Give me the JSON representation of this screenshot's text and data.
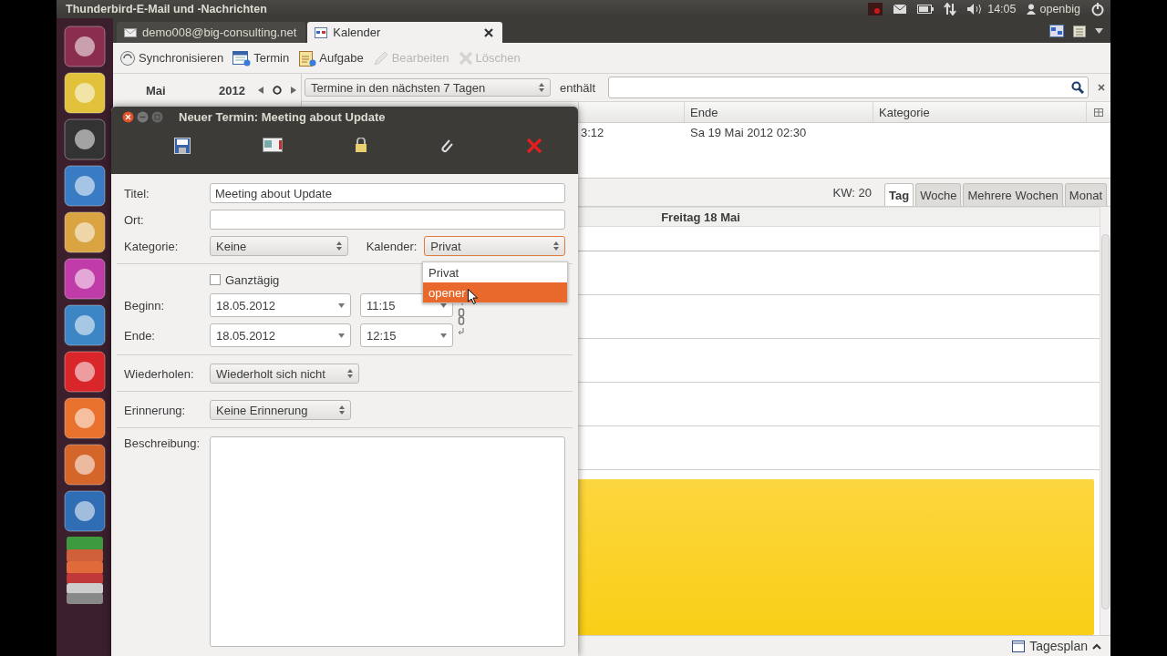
{
  "top_bar": {
    "title": "Thunderbird-E-Mail und -Nachrichten",
    "clock": "14:05",
    "user": "openbig"
  },
  "tabs": [
    {
      "label": "demo008@big-consulting.net",
      "selected": false,
      "kind": "mail"
    },
    {
      "label": "Kalender",
      "selected": true,
      "kind": "calendar"
    }
  ],
  "toolbar": [
    {
      "label": "Synchronisieren",
      "disabled": false,
      "kind": "sync"
    },
    {
      "label": "Termin",
      "disabled": false,
      "kind": "event"
    },
    {
      "label": "Aufgabe",
      "disabled": false,
      "kind": "task"
    },
    {
      "label": "Bearbeiten",
      "disabled": true,
      "kind": "edit"
    },
    {
      "label": "Löschen",
      "disabled": true,
      "kind": "delete"
    }
  ],
  "mini_calendar": {
    "month": "Mai",
    "year": "2012"
  },
  "filter": {
    "range": "Termine in den nächsten 7 Tagen",
    "contains_label": "enthält"
  },
  "event_list": {
    "columns": [
      "Ende",
      "Kategorie"
    ],
    "rows": [
      {
        "column_2": "3:12",
        "end": "Sa 19 Mai 2012 02:30"
      }
    ]
  },
  "view": {
    "week_label": "KW: 20",
    "tabs": [
      {
        "label": "Tag",
        "selected": true
      },
      {
        "label": "Woche",
        "selected": false
      },
      {
        "label": "Mehrere Wochen",
        "selected": false
      },
      {
        "label": "Monat",
        "selected": false
      }
    ],
    "day_header": "Freitag 18 Mai"
  },
  "status_bar": {
    "today_pane": "Tagesplan"
  },
  "dialog": {
    "title": "Neuer Termin: Meeting about Update",
    "title_label": "Titel:",
    "title_value": "Meeting about Update",
    "location_label": "Ort:",
    "category_label": "Kategorie:",
    "category_value": "Keine",
    "calendar_label": "Kalender:",
    "calendar_value": "Privat",
    "calendar_options": [
      {
        "label": "Privat",
        "selected": false
      },
      {
        "label": "opener",
        "selected": true
      }
    ],
    "all_day": {
      "label": "Ganztägig",
      "checked": false
    },
    "start_label": "Beginn:",
    "start_date": "18.05.2012",
    "start_time": "11:15",
    "end_label": "Ende:",
    "end_date": "18.05.2012",
    "end_time": "12:15",
    "repeat_label": "Wiederholen:",
    "repeat_value": "Wiederholt sich nicht",
    "reminder_label": "Erinnerung:",
    "reminder_value": "Keine Erinnerung",
    "description_label": "Beschreibung:"
  }
}
